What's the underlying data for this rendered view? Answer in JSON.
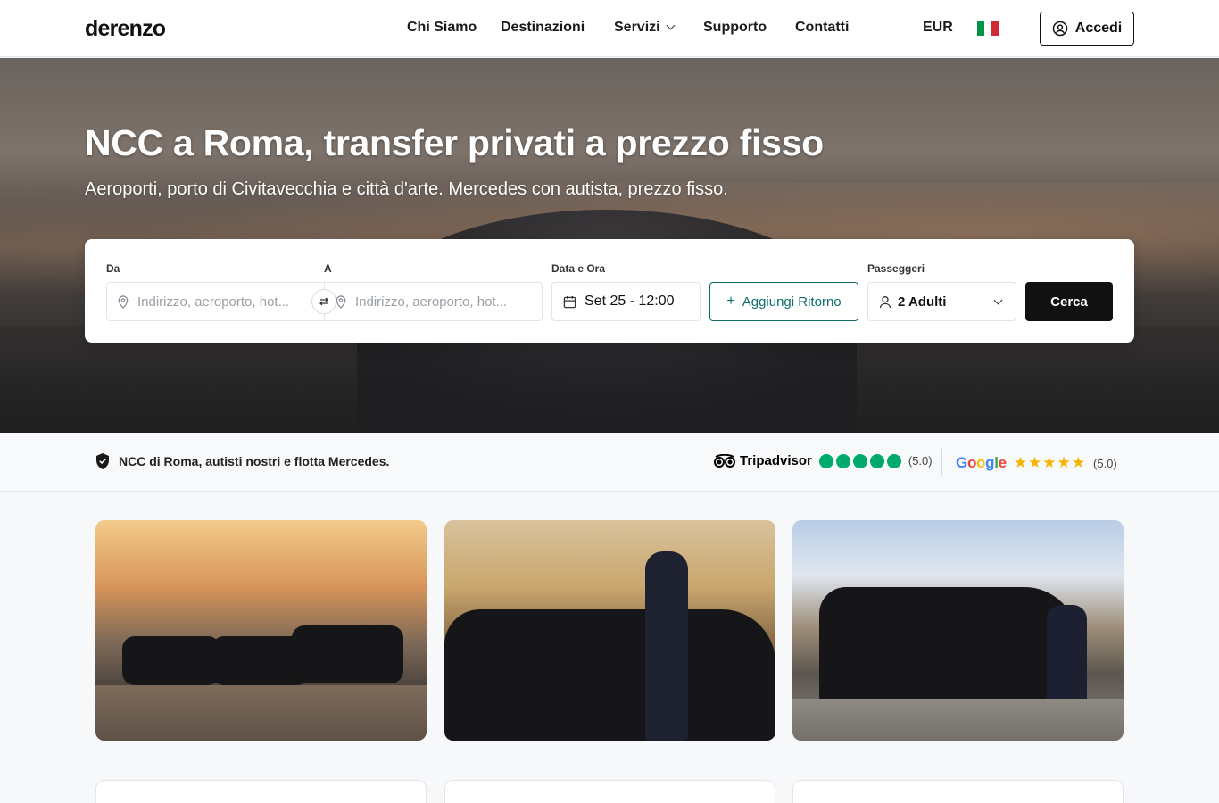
{
  "header": {
    "logo": "derenzo",
    "nav": [
      {
        "label": "Chi Siamo"
      },
      {
        "label": "Destinazioni"
      },
      {
        "label": "Servizi"
      },
      {
        "label": "Supporto"
      },
      {
        "label": "Contatti"
      }
    ],
    "currency": "EUR",
    "language_flag": "italy-flag",
    "login_label": "Accedi"
  },
  "hero": {
    "title": "NCC a Roma, transfer privati a prezzo fisso",
    "subtitle": "Aeroporti, porto di Civitavecchia e città d'arte. Mercedes con autista, prezzo fisso."
  },
  "search": {
    "from_label": "Da",
    "from_placeholder": "Indirizzo, aeroporto, hot...",
    "to_label": "A",
    "to_placeholder": "Indirizzo, aeroporto, hot...",
    "date_label": "Data e Ora",
    "date_value": "Set 25 - 12:00",
    "return_label": "Aggiungi Ritorno",
    "passengers_label": "Passeggeri",
    "passengers_value": "2 Adulti",
    "search_label": "Cerca"
  },
  "trust": {
    "tagline": "NCC di Roma, autisti nostri e flotta Mercedes.",
    "tripadvisor": {
      "brand": "Tripadvisor",
      "rating": 5,
      "score": "(5.0)"
    },
    "google": {
      "brand": "Google",
      "stars": "★★★★★",
      "score": "(5.0)"
    }
  },
  "colors": {
    "accent": "#0e6e6a",
    "tripadvisor_green": "#00aa6c",
    "star_yellow": "#f4b400",
    "button_dark": "#111111"
  }
}
